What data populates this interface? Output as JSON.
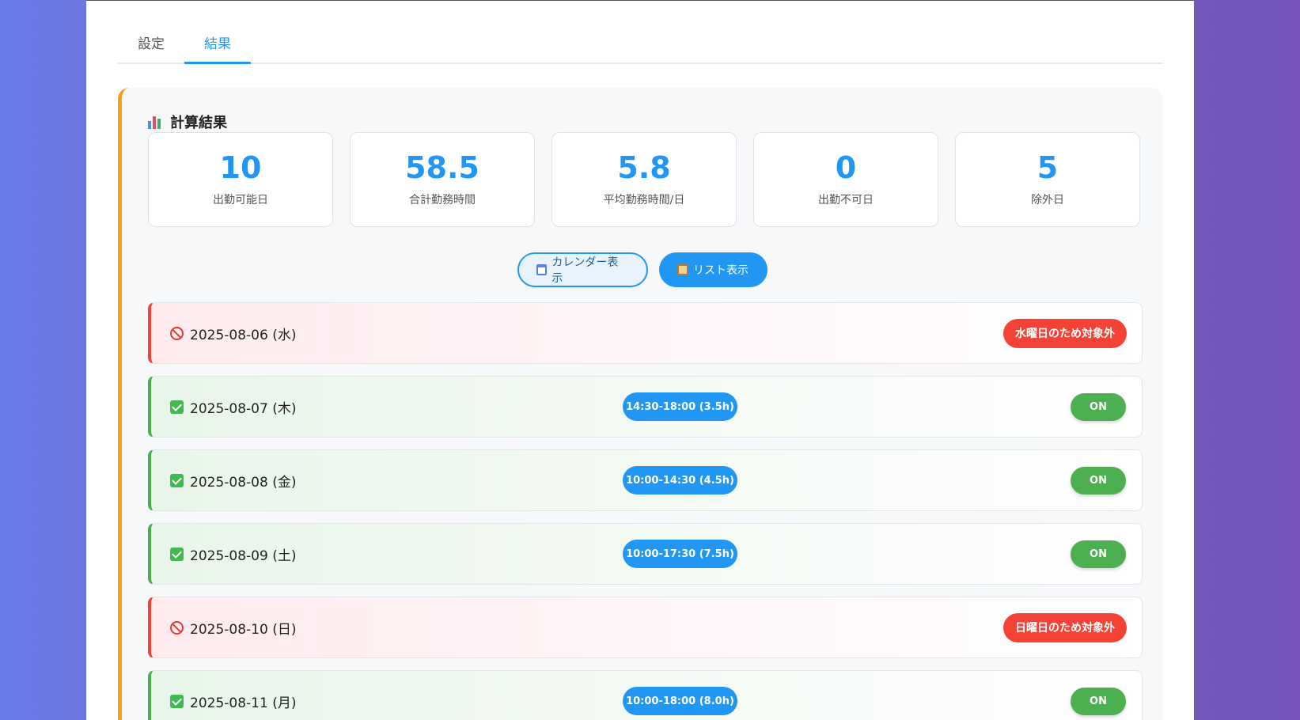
{
  "tabs": [
    {
      "label": "設定",
      "active": false
    },
    {
      "label": "結果",
      "active": true
    }
  ],
  "results": {
    "title": "計算結果",
    "stats": [
      {
        "value": "10",
        "label": "出勤可能日"
      },
      {
        "value": "58.5",
        "label": "合計勤務時間"
      },
      {
        "value": "5.8",
        "label": "平均勤務時間/日"
      },
      {
        "value": "0",
        "label": "出勤不可日"
      },
      {
        "value": "5",
        "label": "除外日"
      }
    ],
    "view_buttons": {
      "calendar": "カレンダー表示",
      "list": "リスト表示"
    },
    "rows": [
      {
        "date": "2025-08-06 (水)",
        "status": "excluded",
        "badge": "水曜日のため対象外"
      },
      {
        "date": "2025-08-07 (木)",
        "status": "work",
        "time": "14:30-18:00 (3.5h)",
        "toggle": "ON"
      },
      {
        "date": "2025-08-08 (金)",
        "status": "work",
        "time": "10:00-14:30 (4.5h)",
        "toggle": "ON"
      },
      {
        "date": "2025-08-09 (土)",
        "status": "work",
        "time": "10:00-17:30 (7.5h)",
        "toggle": "ON"
      },
      {
        "date": "2025-08-10 (日)",
        "status": "excluded",
        "badge": "日曜日のため対象外"
      },
      {
        "date": "2025-08-11 (月)",
        "status": "work",
        "time": "10:00-18:00 (8.0h)",
        "toggle": "ON"
      }
    ]
  },
  "colors": {
    "accent": "#2196f3",
    "excluded": "#f44336",
    "work": "#4caf50",
    "panel_border": "#f5a019"
  }
}
